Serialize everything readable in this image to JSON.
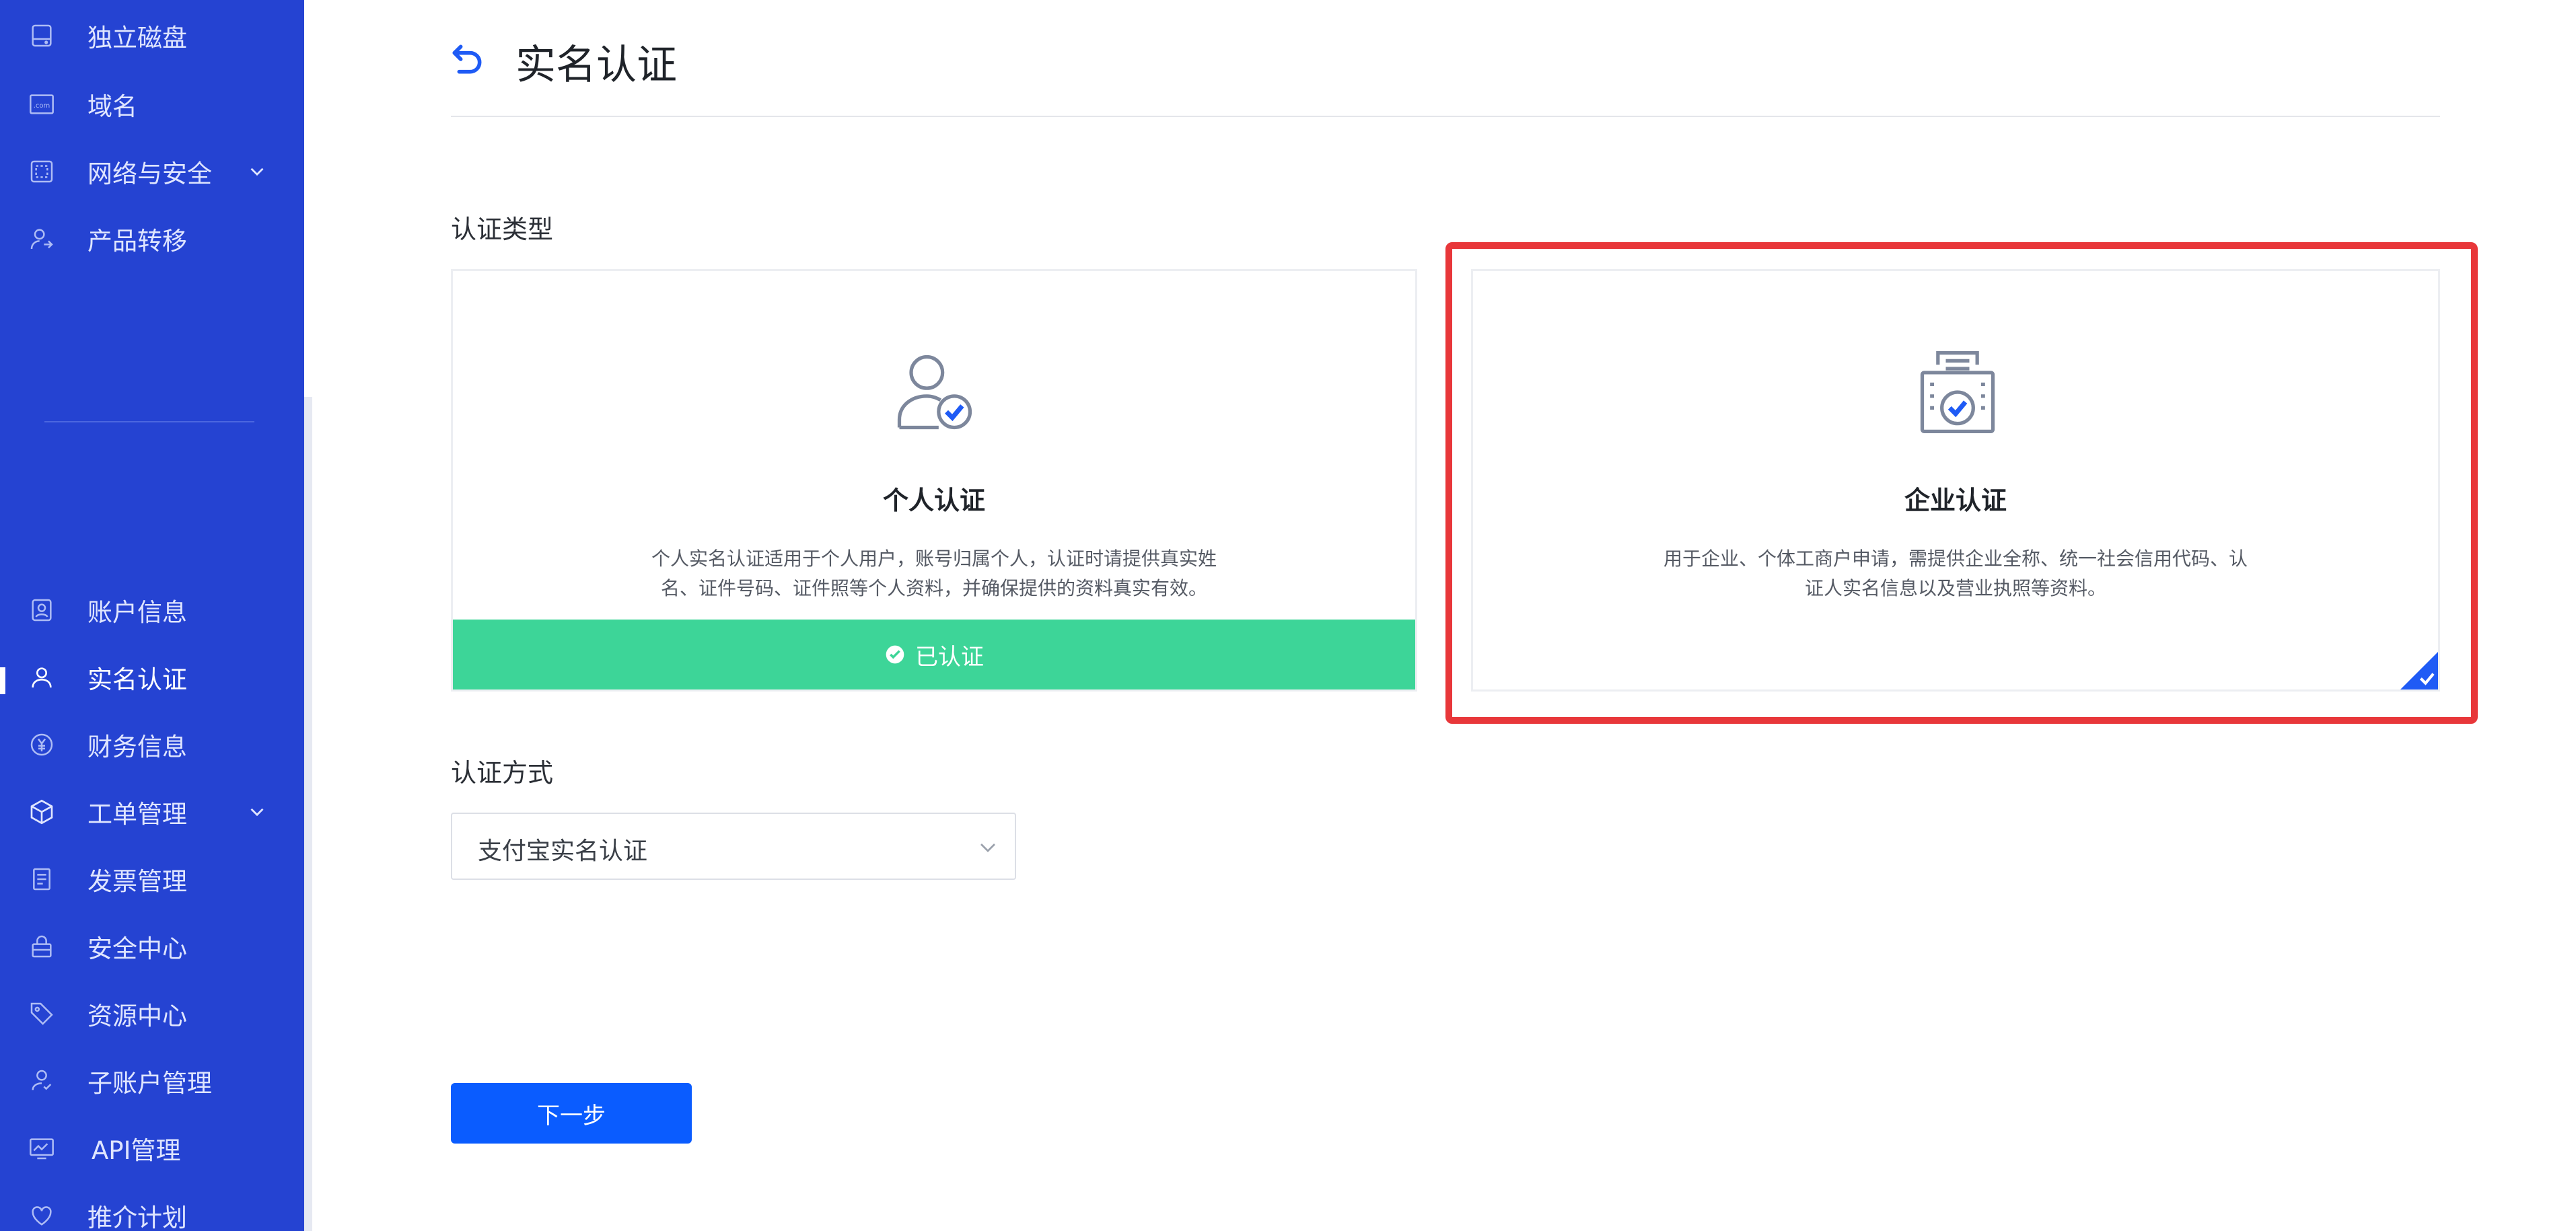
{
  "sidebar": {
    "items": [
      {
        "label": "独立磁盘",
        "icon": "disk-icon"
      },
      {
        "label": "域名",
        "icon": "domain-icon"
      },
      {
        "label": "网络与安全",
        "icon": "network-icon"
      },
      {
        "label": "产品转移",
        "icon": "transfer-icon"
      },
      {
        "label": "账户信息",
        "icon": "account-icon"
      },
      {
        "label": "实名认证",
        "icon": "user-icon"
      },
      {
        "label": "财务信息",
        "icon": "yen-icon"
      },
      {
        "label": "工单管理",
        "icon": "cube-icon"
      },
      {
        "label": "发票管理",
        "icon": "invoice-icon"
      },
      {
        "label": "安全中心",
        "icon": "lock-icon"
      },
      {
        "label": "资源中心",
        "icon": "tag-icon"
      },
      {
        "label": "子账户管理",
        "icon": "sub-account-icon"
      },
      {
        "label": "API管理",
        "icon": "api-icon"
      },
      {
        "label": "推介计划",
        "icon": "heart-icon"
      }
    ],
    "domain_icon_text": ".com",
    "active_item": "实名认证"
  },
  "header": {
    "title": "实名认证"
  },
  "auth_type": {
    "label": "认证类型",
    "personal": {
      "title": "个人认证",
      "desc_line1": "个人实名认证适用于个人用户，账号归属个人，认证时请提供真实姓",
      "desc_line2": "名、证件号码、证件照等个人资料，并确保提供的资料真实有效。",
      "status": "已认证"
    },
    "company": {
      "title": "企业认证",
      "desc_line1": "用于企业、个体工商户申请，需提供企业全称、统一社会信用代码、认",
      "desc_line2": "证人实名信息以及营业执照等资料。",
      "selected": true
    }
  },
  "auth_method": {
    "label": "认证方式",
    "selected": "支付宝实名认证"
  },
  "actions": {
    "next_label": "下一步"
  },
  "colors": {
    "sidebar": "#2543d2",
    "accent": "#0a5cff",
    "verified": "#3dd598",
    "highlight": "#e8373a"
  }
}
